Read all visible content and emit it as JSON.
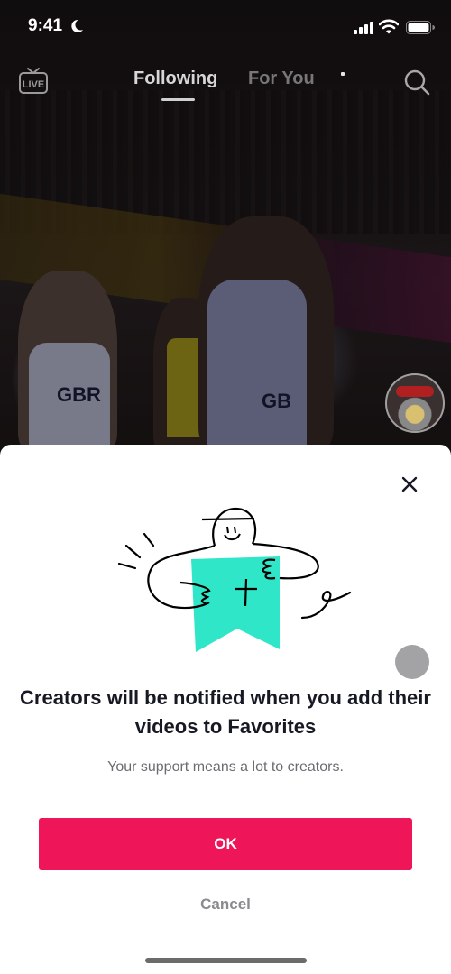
{
  "status_bar": {
    "time": "9:41",
    "icons": [
      "moon-icon",
      "signal-icon",
      "wifi-icon",
      "battery-icon"
    ]
  },
  "top_nav": {
    "live_label": "LIVE",
    "tabs": [
      {
        "label": "Following",
        "active": true
      },
      {
        "label": "For You",
        "active": false
      }
    ],
    "search_icon": "search-icon"
  },
  "video": {
    "jersey_labels": [
      "GBR",
      "GB"
    ]
  },
  "sheet": {
    "title": "Creators will be notified when you add their videos to Favorites",
    "subtitle": "Your support means a lot to creators.",
    "ok_label": "OK",
    "cancel_label": "Cancel",
    "close_icon": "close-icon",
    "illustration": "favorites-bookmark-hug-illustration"
  },
  "colors": {
    "primary": "#ee1558",
    "bookmark": "#2fe6c8",
    "title_text": "#161823",
    "subtitle_text": "#6b6b73",
    "cancel_text": "#8a8a8f"
  }
}
